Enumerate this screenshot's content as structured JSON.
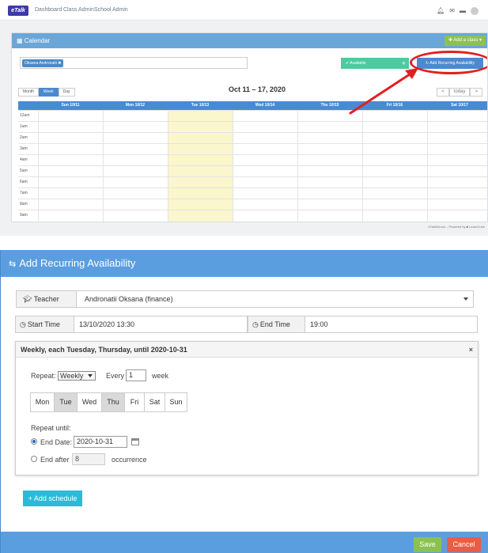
{
  "topnav": {
    "logo": "eTalk",
    "links": [
      "Dashboard",
      "Class Admin",
      "School Admin"
    ],
    "icons": [
      "bell-icon",
      "envelope-icon",
      "card-icon",
      "avatar"
    ]
  },
  "calendar": {
    "panel_title": "Calendar",
    "add_class_label": "✚ Add a class ▾",
    "teacher_tag": "Oksana Andronatii ✖",
    "available_label": "✔ Available",
    "available_plus": "+",
    "add_recurring_label": "↻ Add Recurring Availability",
    "views": [
      "Month",
      "Week",
      "Day"
    ],
    "active_view": "Week",
    "range_title": "Oct 11 – 17, 2020",
    "nav": [
      "<",
      "today",
      ">"
    ],
    "day_headers": [
      "Sun 10/11",
      "Mon 10/12",
      "Tue 10/13",
      "Wed 10/14",
      "Thu 10/15",
      "Fri 10/16",
      "Sat 10/17"
    ],
    "times": [
      "12am",
      "1am",
      "2am",
      "3am",
      "4am",
      "5am",
      "6am",
      "7am",
      "8am",
      "9am"
    ],
    "powered_by": "eTalkSchool – Powered by ■ LearnCube"
  },
  "modal": {
    "title": "Add Recurring Availability",
    "teacher_label": "Teacher",
    "teacher_value": "Andronatii Oksana (finance)",
    "start_label": "Start Time",
    "start_value": "13/10/2020 13:30",
    "end_label": "End Time",
    "end_value": "19:00",
    "recurrence": {
      "summary": "Weekly, each Tuesday, Thursday, until 2020-10-31",
      "close": "×",
      "repeat_label": "Repeat:",
      "repeat_value": "Weekly",
      "every_label": "Every",
      "every_value": "1",
      "every_unit": "week",
      "days": [
        {
          "label": "Mon",
          "selected": false
        },
        {
          "label": "Tue",
          "selected": true
        },
        {
          "label": "Wed",
          "selected": false
        },
        {
          "label": "Thu",
          "selected": true
        },
        {
          "label": "Fri",
          "selected": false
        },
        {
          "label": "Sat",
          "selected": false
        },
        {
          "label": "Sun",
          "selected": false
        }
      ],
      "repeat_until_label": "Repeat until:",
      "end_date_label": "End Date:",
      "end_date_value": "2020-10-31",
      "end_after_label": "End after",
      "end_after_value": "8",
      "occurrence_label": "occurrence"
    },
    "add_schedule_label": "+ Add schedule",
    "save_label": "Save",
    "cancel_label": "Cancel"
  },
  "colors": {
    "header_blue": "#5b9ee0",
    "save_green": "#8cc152",
    "cancel_red": "#e95d46",
    "highlight_red": "#e02020",
    "today_yellow": "#fbf6cc"
  }
}
